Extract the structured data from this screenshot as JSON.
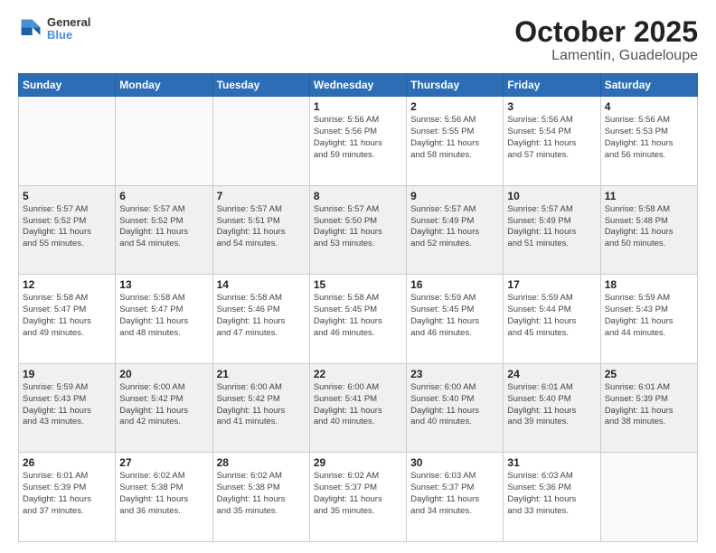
{
  "header": {
    "logo_line1": "General",
    "logo_line2": "Blue",
    "title": "October 2025",
    "subtitle": "Lamentin, Guadeloupe"
  },
  "days_of_week": [
    "Sunday",
    "Monday",
    "Tuesday",
    "Wednesday",
    "Thursday",
    "Friday",
    "Saturday"
  ],
  "weeks": [
    {
      "shaded": false,
      "days": [
        {
          "num": "",
          "info": ""
        },
        {
          "num": "",
          "info": ""
        },
        {
          "num": "",
          "info": ""
        },
        {
          "num": "1",
          "info": "Sunrise: 5:56 AM\nSunset: 5:56 PM\nDaylight: 11 hours\nand 59 minutes."
        },
        {
          "num": "2",
          "info": "Sunrise: 5:56 AM\nSunset: 5:55 PM\nDaylight: 11 hours\nand 58 minutes."
        },
        {
          "num": "3",
          "info": "Sunrise: 5:56 AM\nSunset: 5:54 PM\nDaylight: 11 hours\nand 57 minutes."
        },
        {
          "num": "4",
          "info": "Sunrise: 5:56 AM\nSunset: 5:53 PM\nDaylight: 11 hours\nand 56 minutes."
        }
      ]
    },
    {
      "shaded": true,
      "days": [
        {
          "num": "5",
          "info": "Sunrise: 5:57 AM\nSunset: 5:52 PM\nDaylight: 11 hours\nand 55 minutes."
        },
        {
          "num": "6",
          "info": "Sunrise: 5:57 AM\nSunset: 5:52 PM\nDaylight: 11 hours\nand 54 minutes."
        },
        {
          "num": "7",
          "info": "Sunrise: 5:57 AM\nSunset: 5:51 PM\nDaylight: 11 hours\nand 54 minutes."
        },
        {
          "num": "8",
          "info": "Sunrise: 5:57 AM\nSunset: 5:50 PM\nDaylight: 11 hours\nand 53 minutes."
        },
        {
          "num": "9",
          "info": "Sunrise: 5:57 AM\nSunset: 5:49 PM\nDaylight: 11 hours\nand 52 minutes."
        },
        {
          "num": "10",
          "info": "Sunrise: 5:57 AM\nSunset: 5:49 PM\nDaylight: 11 hours\nand 51 minutes."
        },
        {
          "num": "11",
          "info": "Sunrise: 5:58 AM\nSunset: 5:48 PM\nDaylight: 11 hours\nand 50 minutes."
        }
      ]
    },
    {
      "shaded": false,
      "days": [
        {
          "num": "12",
          "info": "Sunrise: 5:58 AM\nSunset: 5:47 PM\nDaylight: 11 hours\nand 49 minutes."
        },
        {
          "num": "13",
          "info": "Sunrise: 5:58 AM\nSunset: 5:47 PM\nDaylight: 11 hours\nand 48 minutes."
        },
        {
          "num": "14",
          "info": "Sunrise: 5:58 AM\nSunset: 5:46 PM\nDaylight: 11 hours\nand 47 minutes."
        },
        {
          "num": "15",
          "info": "Sunrise: 5:58 AM\nSunset: 5:45 PM\nDaylight: 11 hours\nand 46 minutes."
        },
        {
          "num": "16",
          "info": "Sunrise: 5:59 AM\nSunset: 5:45 PM\nDaylight: 11 hours\nand 46 minutes."
        },
        {
          "num": "17",
          "info": "Sunrise: 5:59 AM\nSunset: 5:44 PM\nDaylight: 11 hours\nand 45 minutes."
        },
        {
          "num": "18",
          "info": "Sunrise: 5:59 AM\nSunset: 5:43 PM\nDaylight: 11 hours\nand 44 minutes."
        }
      ]
    },
    {
      "shaded": true,
      "days": [
        {
          "num": "19",
          "info": "Sunrise: 5:59 AM\nSunset: 5:43 PM\nDaylight: 11 hours\nand 43 minutes."
        },
        {
          "num": "20",
          "info": "Sunrise: 6:00 AM\nSunset: 5:42 PM\nDaylight: 11 hours\nand 42 minutes."
        },
        {
          "num": "21",
          "info": "Sunrise: 6:00 AM\nSunset: 5:42 PM\nDaylight: 11 hours\nand 41 minutes."
        },
        {
          "num": "22",
          "info": "Sunrise: 6:00 AM\nSunset: 5:41 PM\nDaylight: 11 hours\nand 40 minutes."
        },
        {
          "num": "23",
          "info": "Sunrise: 6:00 AM\nSunset: 5:40 PM\nDaylight: 11 hours\nand 40 minutes."
        },
        {
          "num": "24",
          "info": "Sunrise: 6:01 AM\nSunset: 5:40 PM\nDaylight: 11 hours\nand 39 minutes."
        },
        {
          "num": "25",
          "info": "Sunrise: 6:01 AM\nSunset: 5:39 PM\nDaylight: 11 hours\nand 38 minutes."
        }
      ]
    },
    {
      "shaded": false,
      "days": [
        {
          "num": "26",
          "info": "Sunrise: 6:01 AM\nSunset: 5:39 PM\nDaylight: 11 hours\nand 37 minutes."
        },
        {
          "num": "27",
          "info": "Sunrise: 6:02 AM\nSunset: 5:38 PM\nDaylight: 11 hours\nand 36 minutes."
        },
        {
          "num": "28",
          "info": "Sunrise: 6:02 AM\nSunset: 5:38 PM\nDaylight: 11 hours\nand 35 minutes."
        },
        {
          "num": "29",
          "info": "Sunrise: 6:02 AM\nSunset: 5:37 PM\nDaylight: 11 hours\nand 35 minutes."
        },
        {
          "num": "30",
          "info": "Sunrise: 6:03 AM\nSunset: 5:37 PM\nDaylight: 11 hours\nand 34 minutes."
        },
        {
          "num": "31",
          "info": "Sunrise: 6:03 AM\nSunset: 5:36 PM\nDaylight: 11 hours\nand 33 minutes."
        },
        {
          "num": "",
          "info": ""
        }
      ]
    }
  ]
}
